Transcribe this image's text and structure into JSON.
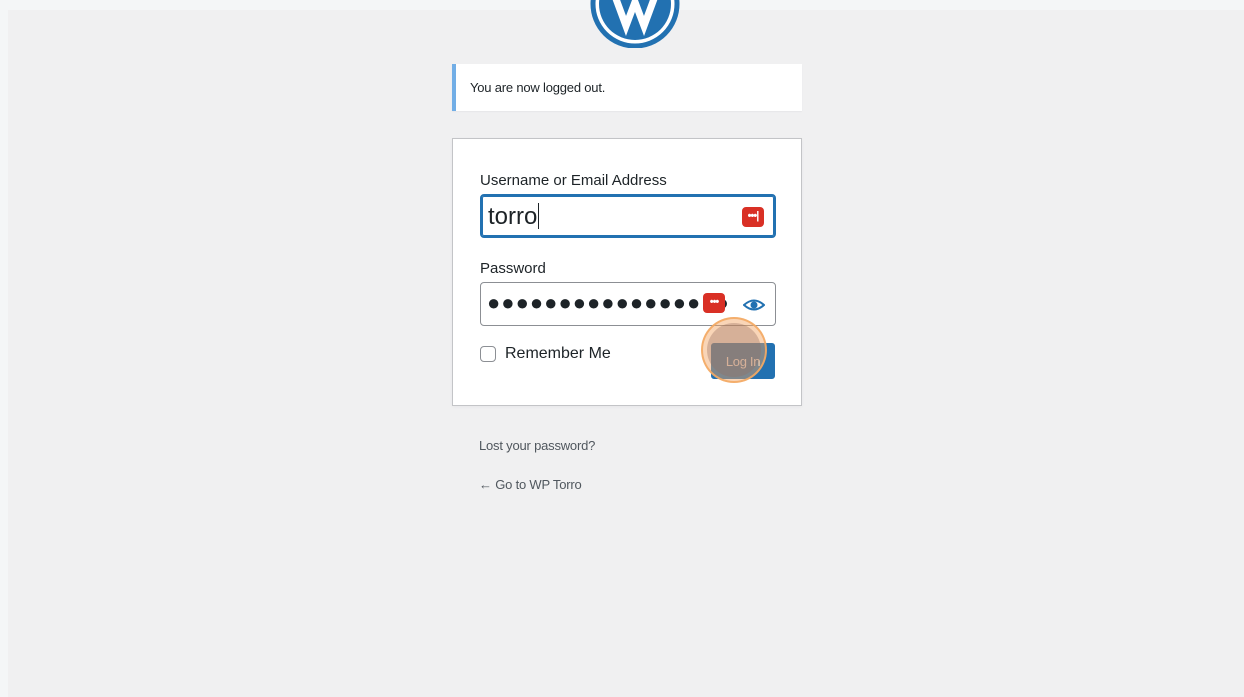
{
  "notice": {
    "text": "You are now logged out."
  },
  "form": {
    "username_label": "Username or Email Address",
    "username_value": "torro",
    "password_label": "Password",
    "password_masked": "●●●●●●●●●●●●●●●●●",
    "remember_label": "Remember Me",
    "remember_checked": false,
    "submit_label": "Log In"
  },
  "links": {
    "lost_password": "Lost your password?",
    "back_to_site": "← Go to WP Torro"
  },
  "icons": {
    "logo": "wordpress-logo-icon",
    "password_manager": "password-manager-icon",
    "show_password": "eye-icon"
  },
  "colors": {
    "accent": "#2271b1",
    "notice_border": "#72aee6",
    "password_manager": "#d93025",
    "background": "#f0f0f1",
    "click_indicator": "#f1a160"
  }
}
